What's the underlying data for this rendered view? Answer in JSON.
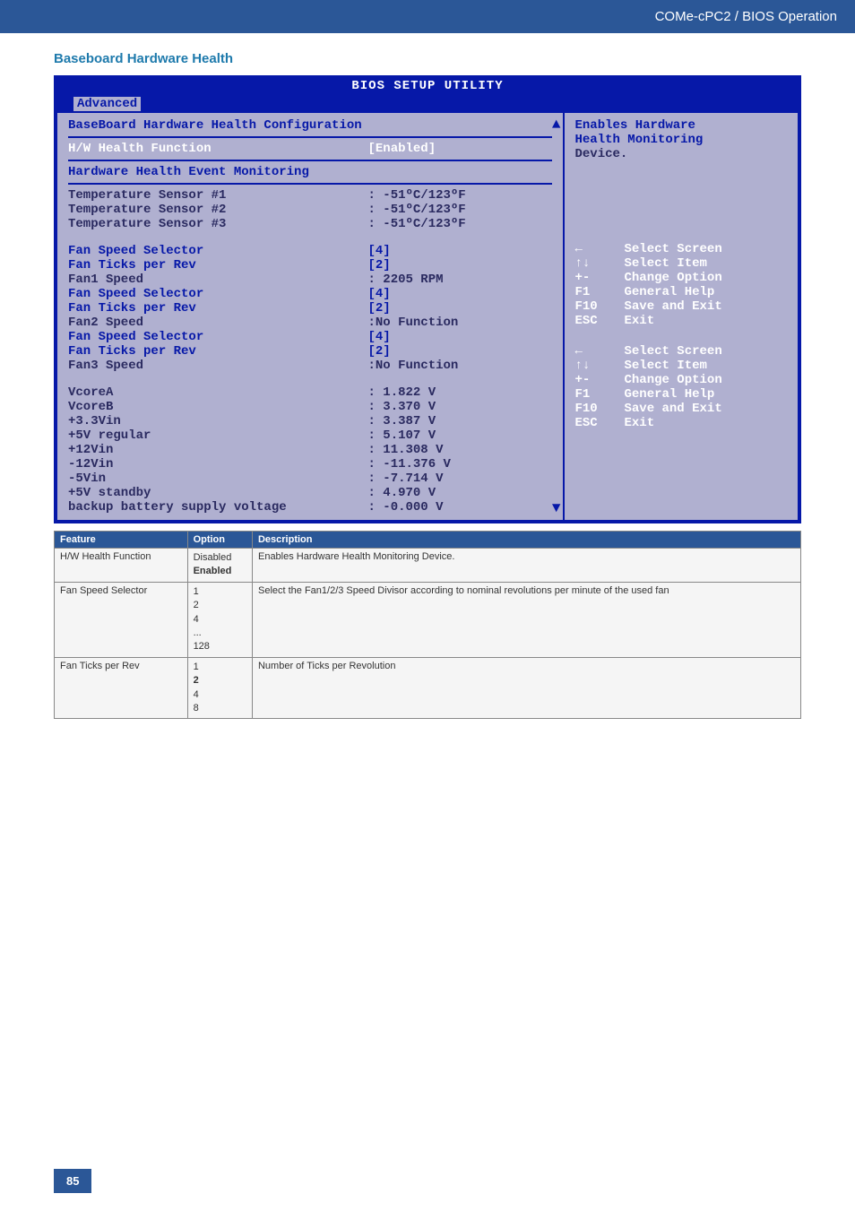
{
  "header": {
    "breadcrumb": "COMe-cPC2 / BIOS Operation"
  },
  "section": {
    "title": "Baseboard Hardware Health"
  },
  "bios": {
    "title": "BIOS SETUP UTILITY",
    "tab": "Advanced",
    "heading1": "BaseBoard Hardware Health Configuration",
    "hw_func_label": "H/W Health Function",
    "hw_func_value": "[Enabled]",
    "heading2": "Hardware Health Event Monitoring",
    "temps": [
      {
        "label": "Temperature Sensor #1",
        "value": ": -51ºC/123ºF"
      },
      {
        "label": "Temperature Sensor #2",
        "value": ": -51ºC/123ºF"
      },
      {
        "label": "Temperature Sensor #3",
        "value": ": -51ºC/123ºF"
      }
    ],
    "fans": [
      {
        "label": "Fan Speed Selector",
        "value": "[4]",
        "cls": "navy"
      },
      {
        "label": "Fan Ticks per Rev",
        "value": "[2]",
        "cls": "navy"
      },
      {
        "label": "Fan1 Speed",
        "value": ": 2205 RPM",
        "cls": "dark"
      },
      {
        "label": "Fan Speed Selector",
        "value": "[4]",
        "cls": "navy"
      },
      {
        "label": "Fan Ticks per Rev",
        "value": "[2]",
        "cls": "navy"
      },
      {
        "label": "Fan2 Speed",
        "value": ":No Function",
        "cls": "dark"
      },
      {
        "label": "Fan Speed Selector",
        "value": "[4]",
        "cls": "navy"
      },
      {
        "label": "Fan Ticks per Rev",
        "value": "[2]",
        "cls": "navy"
      },
      {
        "label": "Fan3 Speed",
        "value": ":No Function",
        "cls": "dark"
      }
    ],
    "volts": [
      {
        "label": "VcoreA",
        "value": ": 1.822 V"
      },
      {
        "label": "VcoreB",
        "value": ": 3.370 V"
      },
      {
        "label": "+3.3Vin",
        "value": ": 3.387 V"
      },
      {
        "label": "+5V regular",
        "value": ": 5.107 V"
      },
      {
        "label": "+12Vin",
        "value": ": 11.308 V"
      },
      {
        "label": "-12Vin",
        "value": ": -11.376 V"
      },
      {
        "label": "-5Vin",
        "value": ": -7.714 V"
      },
      {
        "label": "+5V standby",
        "value": ": 4.970 V"
      },
      {
        "label": "backup battery supply voltage",
        "value": ": -0.000 V"
      }
    ],
    "help_desc1": "Enables Hardware",
    "help_desc2": "Health Monitoring",
    "help_desc3": "Device.",
    "nav1": [
      {
        "key": "←",
        "desc": "Select Screen"
      },
      {
        "key": "↑↓",
        "desc": "Select Item"
      },
      {
        "key": "+-",
        "desc": "Change Option"
      },
      {
        "key": "F1",
        "desc": "General Help"
      },
      {
        "key": "F10",
        "desc": "Save and Exit"
      },
      {
        "key": "ESC",
        "desc": "Exit"
      }
    ],
    "nav2": [
      {
        "key": "←",
        "desc": "Select Screen"
      },
      {
        "key": "↑↓",
        "desc": "Select Item"
      },
      {
        "key": "+-",
        "desc": "Change Option"
      },
      {
        "key": "F1",
        "desc": "General Help"
      },
      {
        "key": "F10",
        "desc": "Save and Exit"
      },
      {
        "key": "ESC",
        "desc": "Exit"
      }
    ]
  },
  "table": {
    "headers": {
      "feature": "Feature",
      "option": "Option",
      "description": "Description"
    },
    "rows": [
      {
        "feature": "H/W Health Function",
        "options": [
          "Disabled",
          "Enabled"
        ],
        "bold_idx": 1,
        "description": "Enables Hardware Health Monitoring Device."
      },
      {
        "feature": "Fan Speed Selector",
        "options": [
          "1",
          "2",
          "4",
          "...",
          "128"
        ],
        "bold_idx": -1,
        "description": "Select the Fan1/2/3 Speed Divisor according to nominal revolutions per minute of the used fan"
      },
      {
        "feature": "Fan Ticks per Rev",
        "options": [
          "1",
          "2",
          "4",
          "8"
        ],
        "bold_idx": 1,
        "description": "Number of Ticks per Revolution"
      }
    ]
  },
  "footer": {
    "page": "85"
  }
}
